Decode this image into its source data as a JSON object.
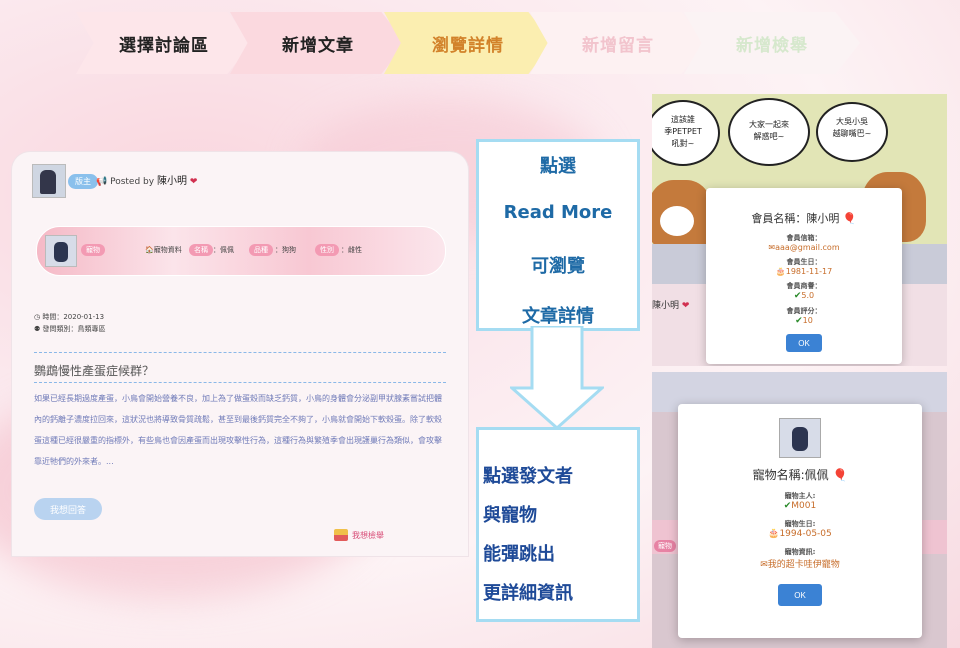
{
  "steps": [
    "選擇討論區",
    "新增文章",
    "瀏覽詳情",
    "新增留言",
    "新增檢舉"
  ],
  "post": {
    "badge": "版主",
    "posted_by": "Posted by",
    "author": "陳小明",
    "pet_chip": "寵物",
    "pet_info_label": "寵物資料",
    "name_chip": "名稱",
    "name_value": "：佩佩",
    "breed_chip": "品種",
    "breed_value": "：狗狗",
    "sex_chip": "性別",
    "sex_value": "：雌性",
    "time": "時間：2020-01-13",
    "category": "發問類別：鳥類專區",
    "title": "鸚鵡慢性產蛋症候群？",
    "body": "如果已經長期過度產蛋，小鳥會開始營養不良，加上為了做蛋殼而缺乏鈣質，小鳥的身體會分泌副甲狀腺素嘗試把體內的鈣離子濃度拉回來，這狀況也將導致骨質疏鬆，甚至到最後鈣質完全不夠了，小鳥就會開始下軟殼蛋。除了軟殼蛋這種已經很嚴重的指標外，有些鳥也會因產蛋而出現攻擊性行為，這種行為與繁殖季會出現護巢行為類似，會攻擊靠近牠們的外來者。...",
    "reply_button": "我想回答",
    "report_link": "我想檢舉"
  },
  "instruction1": [
    "點選",
    "Read More",
    "可瀏覽",
    "文章詳情"
  ],
  "instruction2": [
    "點選發文者",
    "與寵物",
    "能彈跳出",
    "更詳細資訊"
  ],
  "member_modal": {
    "bubbles": [
      "這該誰\n季PETPET\n吼對~",
      "大家一起來\n解惑吧~",
      "大吳小吳\n越聊嘴巴~"
    ],
    "bg_name": "陳小明",
    "title": "會員名稱：陳小明",
    "email_label": "會員信箱：",
    "email": "aaa@gmail.com",
    "birthday_label": "會員生日：",
    "birthday": "1981-11-17",
    "reputation_label": "會員商譽：",
    "reputation": "5.0",
    "rating_label": "會員評分：",
    "rating": "10",
    "ok": "OK"
  },
  "pet_modal": {
    "title": "寵物名稱:佩佩",
    "owner_label": "寵物主人:",
    "owner": "M001",
    "birthday_label": "寵物生日:",
    "birthday": "1994-05-05",
    "info_label": "寵物資訊:",
    "info": "我的超卡哇伊寵物",
    "bg_tag": "寵物",
    "ok": "OK"
  },
  "colors": {
    "accent": "#3b82d4",
    "step_active": "#d2822a",
    "heart": "#d13050"
  }
}
